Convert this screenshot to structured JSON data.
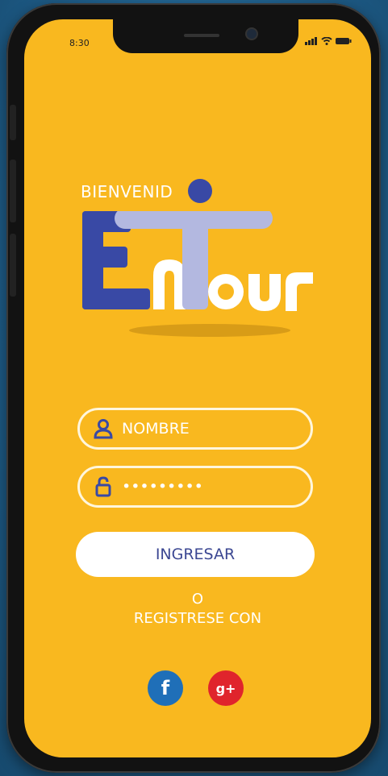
{
  "status_bar": {
    "time": "8:30"
  },
  "welcome": {
    "text": "BIENVENID"
  },
  "logo": {
    "text": "EnTour"
  },
  "form": {
    "name_placeholder": "NOMBRE",
    "password_masked": "•••••••••",
    "login_label": "INGRESAR"
  },
  "alt": {
    "or": "O",
    "register_with": "REGISTRESE CON"
  },
  "social": {
    "facebook": "f",
    "google": "g+"
  },
  "colors": {
    "screen_bg": "#f9b81f",
    "logo_blue": "#3949a5",
    "logo_lavender": "#b3b8e0",
    "button_text": "#3b4792",
    "facebook": "#1f6fb8",
    "google": "#e0242c"
  },
  "icons": [
    "signal-icon",
    "wifi-icon",
    "battery-icon",
    "user-icon",
    "lock-icon",
    "facebook-icon",
    "google-plus-icon"
  ]
}
